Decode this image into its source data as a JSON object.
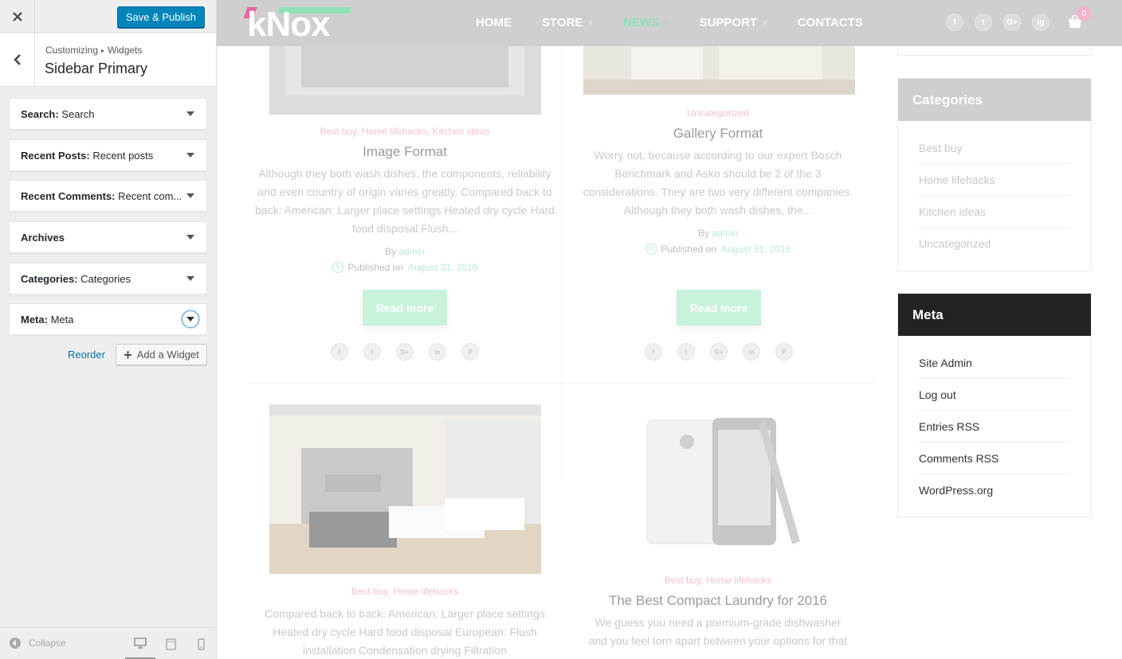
{
  "customizer": {
    "close_icon": "close-icon",
    "save_label": "Save & Publish",
    "breadcrumb": [
      "Customizing",
      "Widgets"
    ],
    "section_title": "Sidebar Primary",
    "widgets": [
      {
        "name": "Search:",
        "sub": "Search"
      },
      {
        "name": "Recent Posts:",
        "sub": "Recent posts"
      },
      {
        "name": "Recent Comments:",
        "sub": "Recent com..."
      },
      {
        "name": "Archives",
        "sub": ""
      },
      {
        "name": "Categories:",
        "sub": "Categories"
      },
      {
        "name": "Meta:",
        "sub": "Meta"
      }
    ],
    "reorder_label": "Reorder",
    "add_widget_label": "Add a Widget",
    "collapse_label": "Collapse",
    "colors": {
      "primary": "#0085ba",
      "link": "#0073aa",
      "panel_bg": "#eeeeee"
    }
  },
  "site": {
    "logo": "kNox",
    "nav": [
      {
        "label": "HOME",
        "caret": false,
        "active": false
      },
      {
        "label": "STORE",
        "caret": true,
        "active": false
      },
      {
        "label": "NEWS",
        "caret": true,
        "active": true
      },
      {
        "label": "SUPPORT",
        "caret": true,
        "active": false
      },
      {
        "label": "CONTACTS",
        "caret": false,
        "active": false
      }
    ],
    "social": [
      "f",
      "t",
      "G+",
      "ig"
    ],
    "cart_count": "0",
    "colors": {
      "accent_green": "#8ee0b8",
      "accent_pink": "#e8649e",
      "header_bg": "#cfcfcf"
    }
  },
  "posts": [
    {
      "categories": "Best buy, Home lifehacks, Kitchen ideas",
      "title": "Image Format",
      "excerpt": "Although they both wash dishes, the components, reliability and even country of origin varies greatly. Compared back to back: American: Larger place settings Heated dry cycle Hard food disposal Flush...",
      "by_prefix": "By",
      "author": "admin",
      "published_prefix": "Published on",
      "date": "August 31, 2016",
      "read_more": "Read more"
    },
    {
      "categories": "Uncategorized",
      "title": "Gallery Format",
      "excerpt": "Worry not, because according to our expert Bosch Benchmark and Asko should be 2 of the 3 considerations. They are two very different companies. Although they both wash dishes, the...",
      "by_prefix": "By",
      "author": "admin",
      "published_prefix": "Published on",
      "date": "August 31, 2016",
      "read_more": "Read more"
    },
    {
      "categories": "Best buy, Home lifehacks",
      "title": "",
      "excerpt": "Compared back to back: American: Larger place settings Heated dry cycle Hard food disposal European: Flush installation Condensation drying Filtration"
    },
    {
      "categories": "Best buy, Home lifehacks",
      "title": "The Best Compact Laundry for 2016",
      "excerpt": "We guess you need a premium-grade dishwasher and you feel torn apart between your options for that"
    }
  ],
  "share": [
    "f",
    "t",
    "G+",
    "in",
    "P"
  ],
  "sidebar": {
    "categories": {
      "title": "Categories",
      "items": [
        "Best buy",
        "Home lifehacks",
        "Kitchen ideas",
        "Uncategorized"
      ]
    },
    "meta": {
      "title": "Meta",
      "items": [
        "Site Admin",
        "Log out",
        "Entries RSS",
        "Comments RSS",
        "WordPress.org"
      ]
    }
  }
}
